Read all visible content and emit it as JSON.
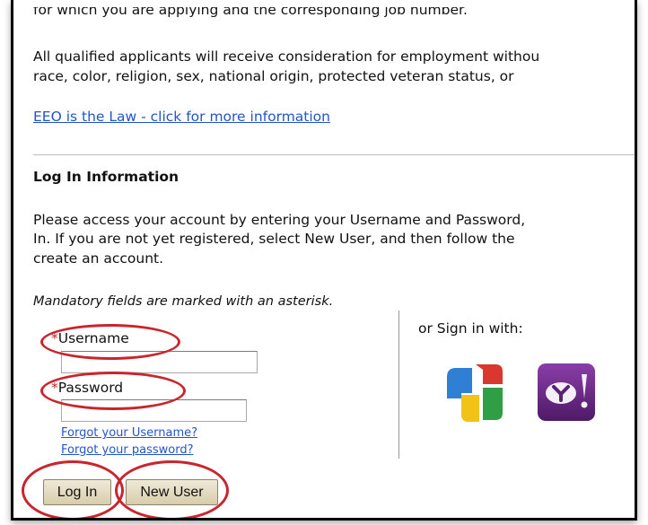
{
  "intro": {
    "line1": "for which you are applying and the corresponding job number.",
    "line2": "All qualified applicants will receive consideration for employment withou",
    "line3": "race, color, religion, sex, national origin, protected veteran status, or"
  },
  "eeo_link": "EEO is the Law - click for more information",
  "login": {
    "heading": "Log In Information",
    "para_line1": "Please access your account by entering your Username and Password,",
    "para_line2": "In. If you are not yet registered, select New User, and then follow the",
    "para_line3": "create an account.",
    "mandatory_note": "Mandatory fields are marked with an asterisk.",
    "required_marker": "*",
    "username_label": "Username",
    "password_label": "Password",
    "username_value": "",
    "password_value": "",
    "forgot_username": "Forgot your Username?",
    "forgot_password": "Forgot your password?",
    "login_button": "Log In",
    "new_user_button": "New User"
  },
  "social": {
    "heading": "or Sign in with:",
    "providers": [
      {
        "name": "google-icon"
      },
      {
        "name": "yahoo-icon"
      }
    ]
  },
  "colors": {
    "link": "#2255cc",
    "annotation": "#c9252d",
    "required": "#cc2222"
  }
}
